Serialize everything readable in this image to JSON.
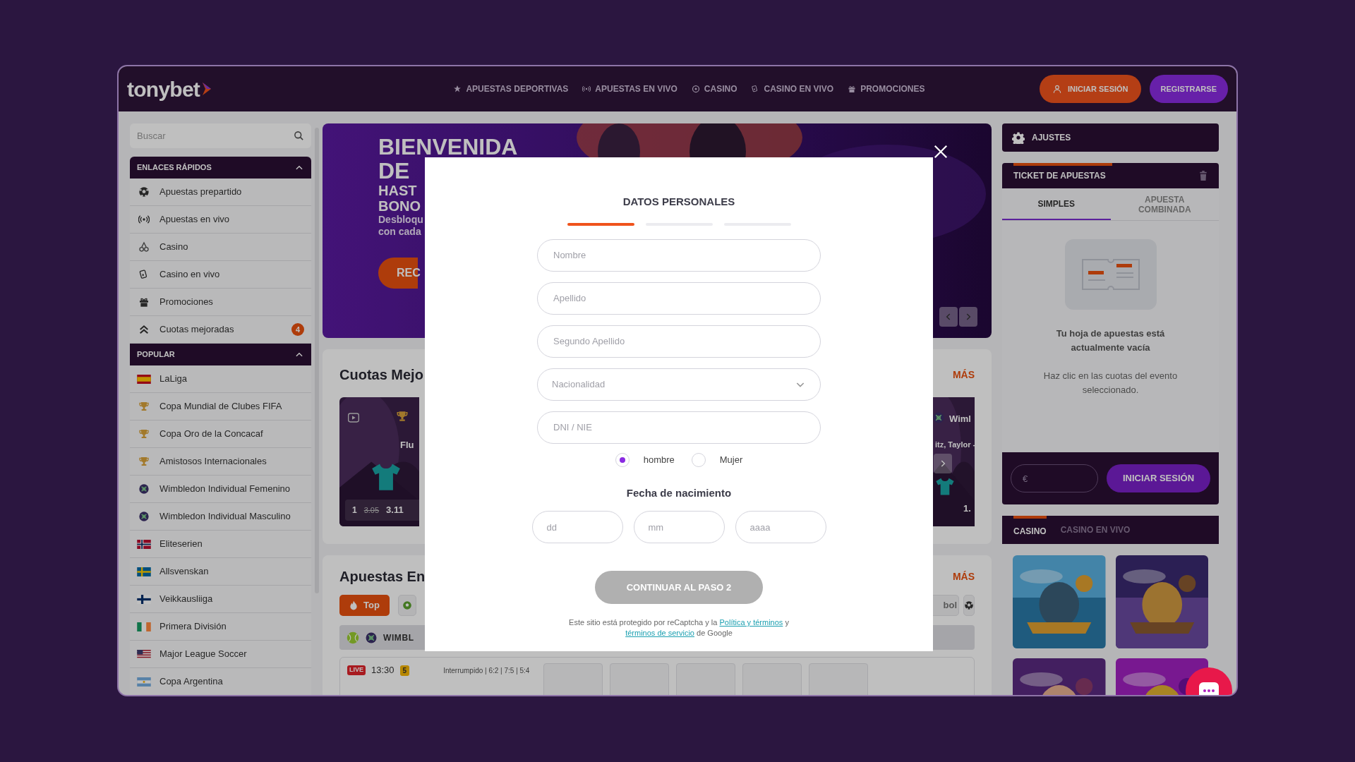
{
  "header": {
    "logo": "tonybet",
    "nav": [
      {
        "label": "APUESTAS DEPORTIVAS",
        "kind": "star"
      },
      {
        "label": "APUESTAS EN VIVO",
        "kind": "live"
      },
      {
        "label": "CASINO",
        "kind": "chip"
      },
      {
        "label": "CASINO EN VIVO",
        "kind": "cards"
      },
      {
        "label": "PROMOCIONES",
        "kind": "gift"
      }
    ],
    "login": "INICIAR SESIÓN",
    "register": "REGISTRARSE"
  },
  "sidebar": {
    "search_placeholder": "Buscar",
    "sections": [
      {
        "title": "ENLACES RÁPIDOS",
        "expanded": true,
        "items": [
          {
            "label": "Apuestas prepartido",
            "kind": "ball"
          },
          {
            "label": "Apuestas en vivo",
            "kind": "live"
          },
          {
            "label": "Casino",
            "kind": "cherries"
          },
          {
            "label": "Casino en vivo",
            "kind": "cards"
          },
          {
            "label": "Promociones",
            "kind": "gift"
          },
          {
            "label": "Cuotas mejoradas",
            "kind": "boost",
            "badge": "4"
          }
        ]
      },
      {
        "title": "POPULAR",
        "expanded": true,
        "items": [
          {
            "label": "LaLiga",
            "kind": "spain"
          },
          {
            "label": "Copa Mundial de Clubes FIFA",
            "kind": "trophy"
          },
          {
            "label": "Copa Oro de la Concacaf",
            "kind": "trophy"
          },
          {
            "label": "Amistosos Internacionales",
            "kind": "trophy"
          },
          {
            "label": "Wimbledon Individual Femenino",
            "kind": "tennis"
          },
          {
            "label": "Wimbledon Individual Masculino",
            "kind": "tennis"
          },
          {
            "label": "Eliteserien",
            "kind": "norway"
          },
          {
            "label": "Allsvenskan",
            "kind": "sweden"
          },
          {
            "label": "Veikkausliiga",
            "kind": "finland"
          },
          {
            "label": "Primera División",
            "kind": "ireland"
          },
          {
            "label": "Major League Soccer",
            "kind": "usa"
          },
          {
            "label": "Copa Argentina",
            "kind": "argentina"
          }
        ]
      }
    ]
  },
  "banner": {
    "lines": [
      {
        "text": "BIENVENIDA",
        "kind": "headline"
      },
      {
        "text": "DE",
        "kind": "headline"
      },
      {
        "text": "HAST",
        "kind": "sub"
      },
      {
        "text": "BONO",
        "kind": "sub"
      },
      {
        "text": "Desbloqu",
        "kind": "body"
      },
      {
        "text": "con cada",
        "kind": "body"
      }
    ],
    "button": "REC"
  },
  "boosted": {
    "title": "Cuotas Mejo",
    "more": "MÁS",
    "left_card": {
      "team": "Flu",
      "pick": "1",
      "old_odds": "3.05",
      "odds": "3.11"
    },
    "right_card": {
      "league": "Wiml",
      "players": "itz, Taylor -",
      "odds": "1."
    }
  },
  "live": {
    "title": "Apuestas En",
    "more": "MÁS",
    "chips": [
      {
        "label": "Top",
        "selected": true
      },
      {
        "label": "bol",
        "selected": false
      }
    ],
    "event_row": {
      "league": "WIMBL"
    },
    "match": {
      "badge": "LIVE",
      "time": "13:30",
      "count": "5",
      "status": "Interrumpido | 6:2 | 7:5 | 5:4"
    }
  },
  "betslip": {
    "settings": "AJUSTES",
    "title": "TICKET DE APUESTAS",
    "tabs": [
      {
        "label": "SIMPLES",
        "selected": true
      },
      {
        "label": "APUESTA COMBINADA",
        "selected": false
      }
    ],
    "empty_title": "Tu hoja de apuestas está actualmente vacía",
    "empty_hint": "Haz clic en las cuotas del evento seleccionado.",
    "stake_placeholder": "€",
    "login": "INICIAR SESIÓN"
  },
  "casino": {
    "tabs": [
      {
        "label": "CASINO",
        "selected": true
      },
      {
        "label": "CASINO EN VIVO",
        "selected": false
      }
    ]
  },
  "modal": {
    "title": "DATOS PERSONALES",
    "steps": [
      {
        "selected": true
      },
      {
        "selected": false
      },
      {
        "selected": false
      }
    ],
    "fields": [
      {
        "placeholder": "Nombre",
        "kind": "text"
      },
      {
        "placeholder": "Apellido",
        "kind": "text"
      },
      {
        "placeholder": "Segundo Apellido",
        "kind": "text"
      },
      {
        "placeholder": "Nacionalidad",
        "kind": "select"
      },
      {
        "placeholder": "DNI / NIE",
        "kind": "text"
      }
    ],
    "gender": [
      {
        "label": "hombre",
        "selected": true
      },
      {
        "label": "Mujer",
        "selected": false
      }
    ],
    "birth_label": "Fecha de nacimiento",
    "birth_fields": [
      {
        "placeholder": "dd"
      },
      {
        "placeholder": "mm"
      },
      {
        "placeholder": "aaaa"
      }
    ],
    "continue": {
      "label": "CONTINUAR AL PASO 2",
      "disabled": true
    },
    "legal": {
      "before": "Este sitio está protegido por reCaptcha y la",
      "link1": "Política y términos",
      "middle": "y",
      "link2": "términos de servicio",
      "after": "de Google"
    }
  }
}
